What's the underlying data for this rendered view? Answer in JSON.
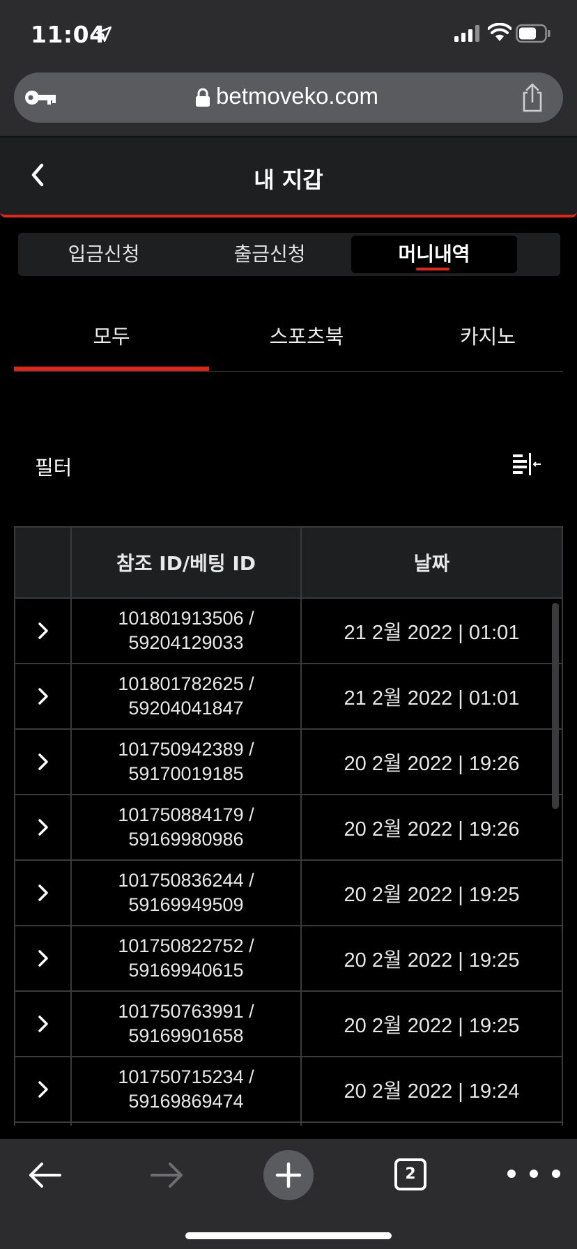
{
  "status_bar": {
    "time": "11:04"
  },
  "browser": {
    "url": "betmoveko.com",
    "tab_count": "2"
  },
  "header": {
    "title": "내 지갑"
  },
  "segments": [
    {
      "label": "입금신청",
      "active": false
    },
    {
      "label": "출금신청",
      "active": false
    },
    {
      "label": "머니내역",
      "active": true
    }
  ],
  "categories": [
    {
      "label": "모두",
      "active": true
    },
    {
      "label": "스포츠북",
      "active": false
    },
    {
      "label": "카지노",
      "active": false
    }
  ],
  "filter": {
    "label": "필터"
  },
  "table": {
    "columns": [
      "",
      "참조 ID/베팅 ID",
      "날짜"
    ],
    "rows": [
      {
        "ref_id": "101801913506 /",
        "bet_id": "59204129033",
        "date": "21 2월 2022 | 01:01"
      },
      {
        "ref_id": "101801782625 /",
        "bet_id": "59204041847",
        "date": "21 2월 2022 | 01:01"
      },
      {
        "ref_id": "101750942389 /",
        "bet_id": "59170019185",
        "date": "20 2월 2022 | 19:26"
      },
      {
        "ref_id": "101750884179 /",
        "bet_id": "59169980986",
        "date": "20 2월 2022 | 19:26"
      },
      {
        "ref_id": "101750836244 /",
        "bet_id": "59169949509",
        "date": "20 2월 2022 | 19:25"
      },
      {
        "ref_id": "101750822752 /",
        "bet_id": "59169940615",
        "date": "20 2월 2022 | 19:25"
      },
      {
        "ref_id": "101750763991 /",
        "bet_id": "59169901658",
        "date": "20 2월 2022 | 19:25"
      },
      {
        "ref_id": "101750715234 /",
        "bet_id": "59169869474",
        "date": "20 2월 2022 | 19:24"
      }
    ]
  },
  "colors": {
    "accent": "#e0251b",
    "panel": "#1e1f21",
    "chrome": "#2c2c2e"
  },
  "icons": [
    "location-arrow-icon",
    "signal-icon",
    "wifi-icon",
    "battery-icon",
    "key-icon",
    "lock-icon",
    "share-icon",
    "chevron-left-icon",
    "filter-icon",
    "chevron-right-icon",
    "arrow-left-icon",
    "arrow-right-icon",
    "plus-icon",
    "more-icon"
  ]
}
